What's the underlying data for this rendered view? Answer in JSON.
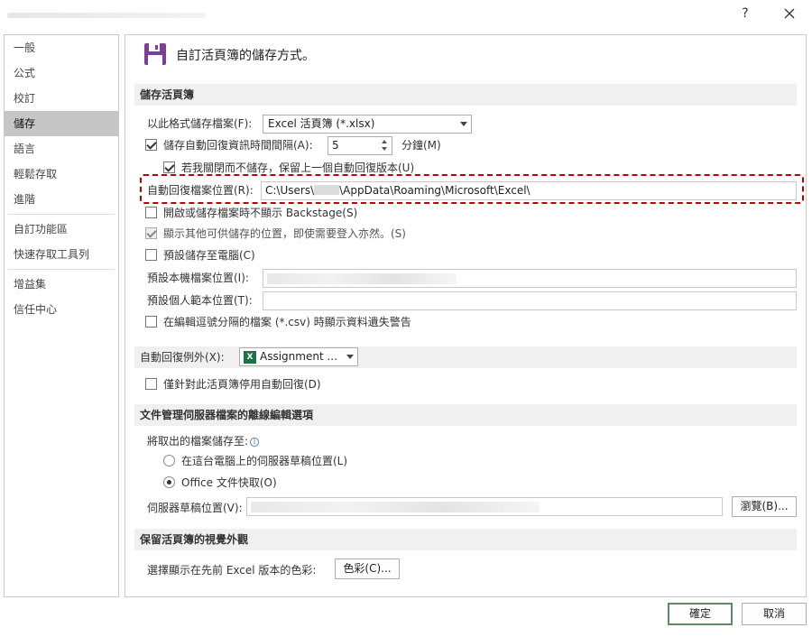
{
  "window": {
    "help_label": "?",
    "close_label": "✕"
  },
  "sidebar": {
    "items": [
      "一般",
      "公式",
      "校訂",
      "儲存",
      "語言",
      "輕鬆存取",
      "進階",
      "自訂功能區",
      "快速存取工具列",
      "增益集",
      "信任中心"
    ],
    "active_index": 3
  },
  "header": {
    "title": "自訂活頁簿的儲存方式。",
    "icon": "floppy-disk-icon",
    "icon_color": "#7b3f98"
  },
  "save_workbooks": {
    "heading": "儲存活頁簿",
    "format_label": "以此格式儲存檔案(F):",
    "format_value": "Excel 活頁簿 (*.xlsx)",
    "autorecover_label": "儲存自動回復資訊時間間隔(A):",
    "autorecover_checked": true,
    "autorecover_minutes": "5",
    "minutes_label": "分鐘(M)",
    "keep_last_label": "若我關閉而不儲存，保留上一個自動回復版本(U)",
    "keep_last_checked": true,
    "autorecover_location_label": "自動回復檔案位置(R):",
    "autorecover_location_value_pre": "C:\\Users\\",
    "autorecover_location_value_post": "\\AppData\\Roaming\\Microsoft\\Excel\\",
    "no_backstage_label": "開啟或儲存檔案時不顯示 Backstage(S)",
    "no_backstage_checked": false,
    "show_locations_label": "顯示其他可供儲存的位置，即使需要登入亦然。(S)",
    "show_locations_checked": true,
    "save_to_computer_label": "預設儲存至電腦(C)",
    "save_to_computer_checked": false,
    "default_local_label": "預設本機檔案位置(I):",
    "default_template_label": "預設個人範本位置(T):",
    "csv_warning_label": "在編輯逗號分隔的檔案 (*.csv) 時顯示資料遺失警告",
    "csv_warning_checked": false
  },
  "autorecover_exceptions": {
    "label": "自動回復例外(X):",
    "value": "Assignment ...",
    "excel_icon_letter": "X",
    "disable_label": "僅針對此活頁簿停用自動回復(D)",
    "disable_checked": false
  },
  "offline_editing": {
    "heading": "文件管理伺服器檔案的離線編輯選項",
    "save_to_label": "將取出的檔案儲存至:",
    "info_symbol": "i",
    "option_server_label": "在這台電腦上的伺服器草稿位置(L)",
    "option_cache_label": "Office 文件快取(O)",
    "selected_option": "cache",
    "drafts_label": "伺服器草稿位置(V):",
    "browse_label": "瀏覽(B)..."
  },
  "preserve_appearance": {
    "heading": "保留活頁簿的視覺外觀",
    "colors_label": "選擇顯示在先前 Excel 版本的色彩:",
    "colors_button": "色彩(C)..."
  },
  "footer": {
    "ok_label": "確定",
    "cancel_label": "取消"
  },
  "colors": {
    "highlight": "#c00000",
    "excel_green": "#1e7145",
    "ok_border": "#5b8c67"
  }
}
